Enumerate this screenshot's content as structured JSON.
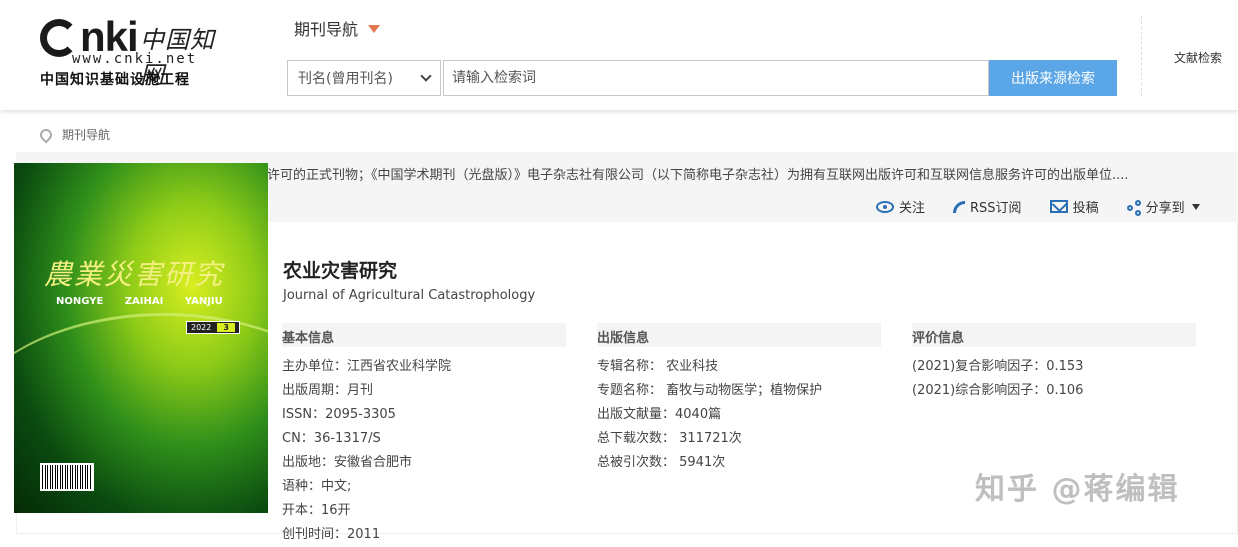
{
  "logo": {
    "brand": "nki",
    "brand_cn": "中国知网",
    "url": "www.cnki.net",
    "subtitle": "中国知识基础设施工程"
  },
  "header": {
    "nav_label": "期刊导航",
    "select_value": "刊名(曾用刊名)",
    "search_placeholder": "请输入检索词",
    "search_button": "出版来源检索",
    "doc_search": "文献检索"
  },
  "breadcrumb": {
    "label": "期刊导航"
  },
  "notice": "许可的正式刊物；《中国学术期刊（光盘版）》电子杂志社有限公司（以下简称电子杂志社）为拥有互联网出版许可和互联网信息服务许可的出版单位......",
  "actions": {
    "follow": "关注",
    "rss": "RSS订阅",
    "submit": "投稿",
    "share": "分享到"
  },
  "cover": {
    "title": "農業災害研究",
    "pinyin": "NONGYE ZAIHAI YANJIU",
    "year": "2022",
    "issue": "3"
  },
  "journal": {
    "title": "农业灾害研究",
    "title_en": "Journal of Agricultural Catastrophology"
  },
  "basic_info": {
    "heading": "基本信息",
    "items": [
      "主办单位：江西省农业科学院",
      "出版周期：月刊",
      "ISSN：2095-3305",
      "CN：36-1317/S",
      "出版地：安徽省合肥市",
      "语种：中文;",
      "开本：16开",
      "创刊时间：2011"
    ]
  },
  "pub_info": {
    "heading": "出版信息",
    "items": [
      "专辑名称：  农业科技",
      "专题名称：  畜牧与动物医学；植物保护",
      "出版文献量：4040篇",
      "总下载次数：  311721次",
      "总被引次数：  5941次"
    ]
  },
  "eval_info": {
    "heading": "评价信息",
    "items": [
      "(2021)复合影响因子：0.153",
      "(2021)综合影响因子：0.106"
    ]
  },
  "watermark": "知乎 @蒋编辑"
}
